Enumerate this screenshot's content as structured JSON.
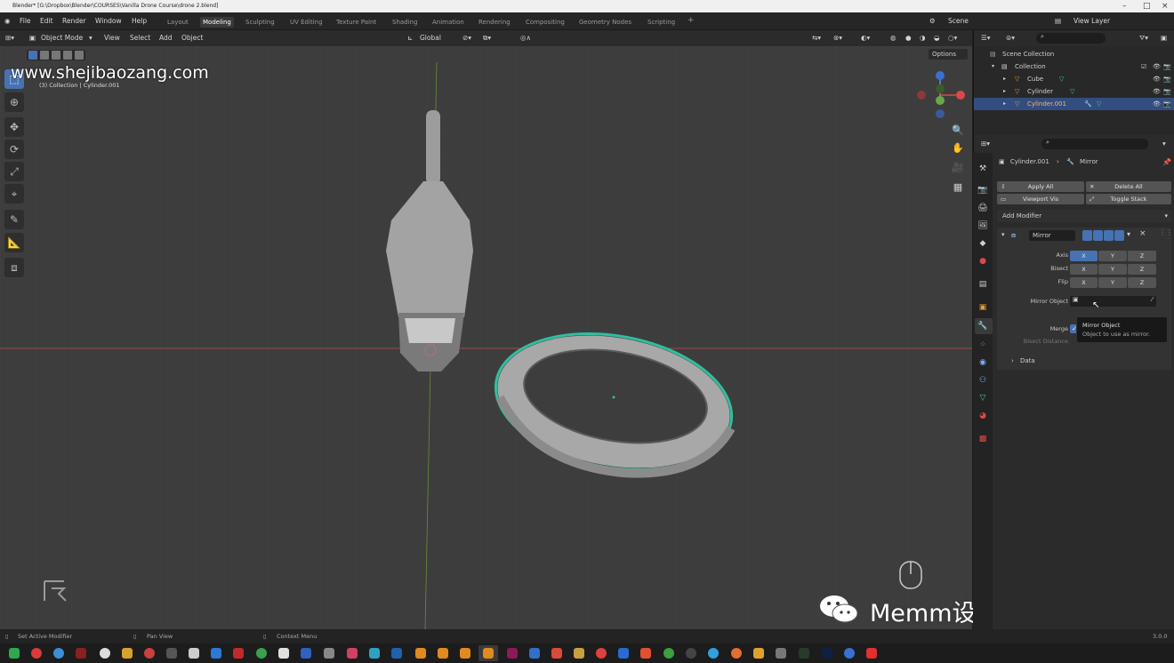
{
  "window_title": "Blender* [G:\\Dropbox\\Blender\\COURSES\\Vanilla Drone Course\\drone 2.blend]",
  "menu": [
    "File",
    "Edit",
    "Render",
    "Window",
    "Help"
  ],
  "workspaces": [
    {
      "label": "Layout",
      "active": false
    },
    {
      "label": "Modeling",
      "active": true
    },
    {
      "label": "Sculpting",
      "active": false
    },
    {
      "label": "UV Editing",
      "active": false
    },
    {
      "label": "Texture Paint",
      "active": false
    },
    {
      "label": "Shading",
      "active": false
    },
    {
      "label": "Animation",
      "active": false
    },
    {
      "label": "Rendering",
      "active": false
    },
    {
      "label": "Compositing",
      "active": false
    },
    {
      "label": "Geometry Nodes",
      "active": false
    },
    {
      "label": "Scripting",
      "active": false
    }
  ],
  "scene_label": "Scene",
  "viewlayer_label": "View Layer",
  "viewport_header": {
    "mode": "Object Mode",
    "menus": [
      "View",
      "Select",
      "Add",
      "Object"
    ],
    "transform": "Global",
    "options": "Options"
  },
  "viewport_info": "(3) Collection | Cylinder.001",
  "watermark_top": "www.shejibaozang.com",
  "watermark_bottom": "Memm设计知识分享",
  "outliner": {
    "root": "Scene Collection",
    "collection": "Collection",
    "items": [
      {
        "label": "Cube",
        "selected": false
      },
      {
        "label": "Cylinder",
        "selected": false
      },
      {
        "label": "Cylinder.001",
        "selected": true
      }
    ]
  },
  "properties": {
    "object": "Cylinder.001",
    "modifier_crumb": "Mirror",
    "apply_all": "Apply All",
    "delete_all": "Delete All",
    "viewport_vis": "Viewport Vis",
    "toggle_stack": "Toggle Stack",
    "add_modifier": "Add Modifier",
    "modifier_name": "Mirror",
    "axis_label": "Axis",
    "bisect_label": "Bisect",
    "flip_label": "Flip",
    "axes": [
      "X",
      "Y",
      "Z"
    ],
    "mirror_object_label": "Mirror Object",
    "merge_label": "Merge",
    "bisect_distance_label": "Bisect Distance",
    "data_label": "Data"
  },
  "tooltip": {
    "title": "Mirror Object",
    "body": "Object to use as mirror."
  },
  "statusbar": {
    "left": "Set Active Modifier",
    "mid": "Pan View",
    "right": "Context Menu",
    "version": "3.0.0"
  },
  "colors": {
    "accent": "#4772b3",
    "selection_outline": "#2fbfa0"
  }
}
